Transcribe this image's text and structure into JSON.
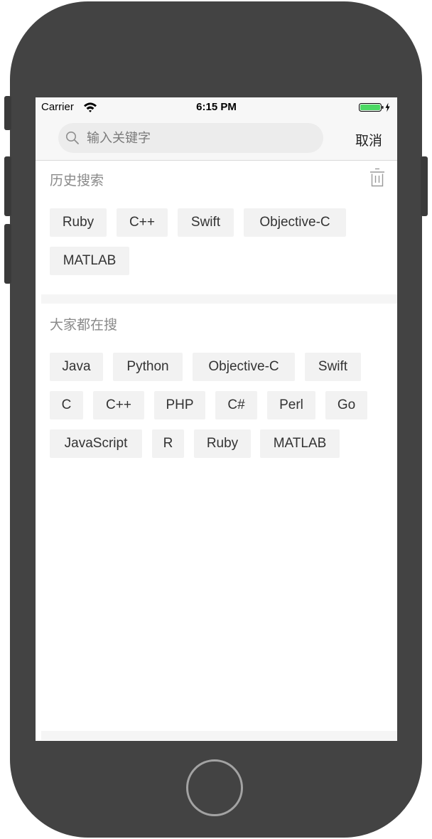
{
  "status_bar": {
    "carrier": "Carrier",
    "time": "6:15 PM",
    "battery_color": "#4cd964"
  },
  "search": {
    "placeholder": "输入关键字",
    "value": "",
    "cancel_label": "取消"
  },
  "history": {
    "title": "历史搜索",
    "tags": [
      "Ruby",
      "C++",
      "Swift",
      "Objective-C",
      "MATLAB"
    ]
  },
  "popular": {
    "title": "大家都在搜",
    "tags": [
      "Java",
      "Python",
      "Objective-C",
      "Swift",
      "C",
      "C++",
      "PHP",
      "C#",
      "Perl",
      "Go",
      "JavaScript",
      "R",
      "Ruby",
      "MATLAB"
    ]
  },
  "colors": {
    "device_frame": "#434343",
    "tag_background": "#f2f2f2",
    "section_title": "#8a8a8a"
  }
}
